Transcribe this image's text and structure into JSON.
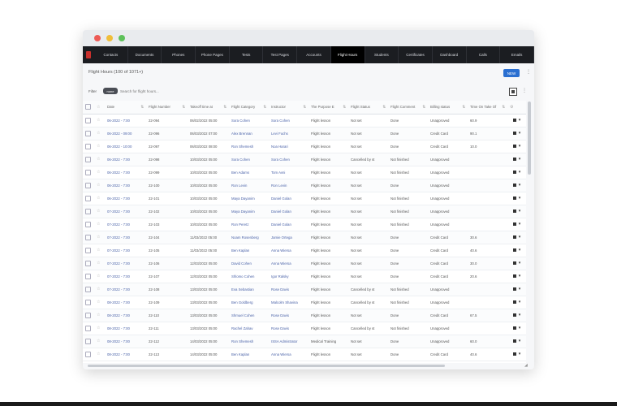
{
  "nav": {
    "tabs": [
      "Contacts",
      "Documents",
      "Phones",
      "Phone Pages",
      "Tests",
      "Test Pages",
      "Accounts",
      "Flight Hours",
      "Students",
      "Certificates",
      "Dashboard",
      "Calls",
      "Emails"
    ],
    "active_index": 7
  },
  "header": {
    "title": "Flight Hours (100 of 1071+)",
    "new_label": "NEW",
    "more": "⋮"
  },
  "filter": {
    "label": "Filter",
    "chip": "none",
    "placeholder": "Search for flight hours...",
    "more": "⋮"
  },
  "table": {
    "columns": [
      "Date",
      "Flight Number",
      "Takeoff time at",
      "Flight Category",
      "Instructor",
      "The Purpose E",
      "Flight Status",
      "Flight Comment",
      "Billing status",
      "Time On Take Of"
    ],
    "rows": [
      [
        "06-2022 - 7:00",
        "22-094",
        "06/02/2022 05:00",
        "Sora Cohen",
        "Sora Cohen",
        "Flight lesson",
        "Not set",
        "Done",
        "Unapproved",
        "60.9"
      ],
      [
        "06-2022 - 09:00",
        "22-096",
        "06/03/2022 07:00",
        "Alex Brennan",
        "Levi Fuchs",
        "Flight lesson",
        "Not set",
        "Done",
        "Credit Card",
        "90.1"
      ],
      [
        "06-2022 - 10:00",
        "22-097",
        "06/03/2022 08:00",
        "Ron Shemesh",
        "Noa Harari",
        "Flight lesson",
        "Not set",
        "Done",
        "Credit Card",
        "10.0"
      ],
      [
        "06-2022 - 7:00",
        "22-098",
        "10/03/2022 05:00",
        "Sora Cohen",
        "Sora Cohen",
        "Flight lesson",
        "Cancelled by st",
        "Not finished",
        "Unapproved",
        ""
      ],
      [
        "06-2022 - 7:00",
        "22-099",
        "10/03/2022 05:00",
        "Ben Adams",
        "Tom Avni",
        "Flight lesson",
        "Not set",
        "Not finished",
        "Unapproved",
        ""
      ],
      [
        "06-2022 - 7:00",
        "22-100",
        "10/03/2022 05:00",
        "Ron Levin",
        "Ron Levin",
        "Flight lesson",
        "Not set",
        "Done",
        "Unapproved",
        ""
      ],
      [
        "06-2022 - 7:00",
        "22-101",
        "10/03/2022 05:00",
        "Maya Dayanim",
        "Daniel Golan",
        "Flight lesson",
        "Not set",
        "Not finished",
        "Unapproved",
        ""
      ],
      [
        "07-2022 - 7:00",
        "22-102",
        "10/03/2022 05:00",
        "Maya Dayanim",
        "Daniel Golan",
        "Flight lesson",
        "Not set",
        "Not finished",
        "Unapproved",
        ""
      ],
      [
        "07-2022 - 7:00",
        "22-103",
        "10/03/2022 05:00",
        "Ron Peretz",
        "Daniel Golan",
        "Flight lesson",
        "Not set",
        "Not finished",
        "Unapproved",
        ""
      ],
      [
        "07-2022 - 7:00",
        "22-104",
        "11/03/2022 05:00",
        "Noam Rosenberg",
        "Jamie Ortega",
        "Flight lesson",
        "Not set",
        "Done",
        "Credit Card",
        "30.6"
      ],
      [
        "07-2022 - 7:00",
        "22-105",
        "11/03/2022 05:00",
        "Ben Kaplan",
        "Anna Wiersa",
        "Flight lesson",
        "Not set",
        "Done",
        "Credit Card",
        "40.6"
      ],
      [
        "07-2022 - 7:00",
        "22-106",
        "12/03/2022 05:00",
        "David Cohen",
        "Anna Wiersa",
        "Flight lesson",
        "Not set",
        "Done",
        "Credit Card",
        "30.0"
      ],
      [
        "07-2022 - 7:00",
        "22-107",
        "12/03/2022 05:00",
        "Shlomo Cohen",
        "Igor Ralsky",
        "Flight lesson",
        "Not set",
        "Done",
        "Credit Card",
        "20.6"
      ],
      [
        "07-2022 - 7:00",
        "22-108",
        "13/03/2022 05:00",
        "Eva Sebastian",
        "Rose Davis",
        "Flight lesson",
        "Cancelled by st",
        "Not finished",
        "Unapproved",
        ""
      ],
      [
        "08-2022 - 7:00",
        "22-109",
        "13/03/2022 05:00",
        "Ben Goldberg",
        "Malcolm Shavina",
        "Flight lesson",
        "Cancelled by st",
        "Not finished",
        "Unapproved",
        ""
      ],
      [
        "08-2022 - 7:00",
        "22-110",
        "13/03/2022 05:00",
        "Shmuel Cohen",
        "Rose Davis",
        "Flight lesson",
        "Not set",
        "Done",
        "Credit Card",
        "67.5"
      ],
      [
        "08-2022 - 7:00",
        "22-111",
        "13/03/2022 05:00",
        "Rachel Zahav",
        "Rose Davis",
        "Flight lesson",
        "Cancelled by st",
        "Not finished",
        "Unapproved",
        ""
      ],
      [
        "08-2022 - 7:00",
        "22-112",
        "14/03/2022 05:00",
        "Ron Shemesh",
        "ISSA Admistrator",
        "Medical Training",
        "Not set",
        "Done",
        "Unapproved",
        "60.0"
      ],
      [
        "08-2022 - 7:00",
        "22-113",
        "14/03/2022 05:00",
        "Ben Kaplan",
        "Anna Wiersa",
        "Flight lesson",
        "Not set",
        "Done",
        "Credit Card",
        "40.6"
      ]
    ]
  },
  "colors": {
    "navbar": "#1b1d21",
    "accent": "#2a6fd1",
    "link": "#4a62a8"
  }
}
